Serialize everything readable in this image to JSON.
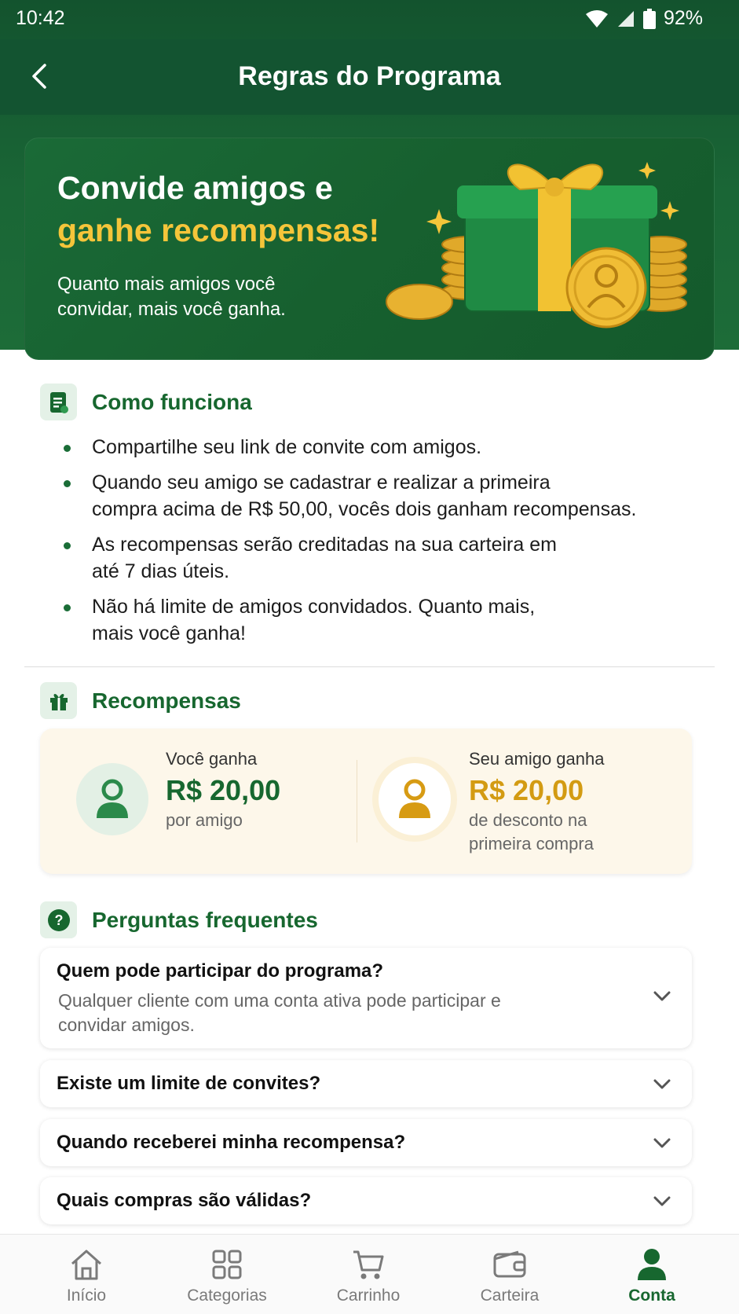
{
  "status_bar": {
    "time": "10:42",
    "battery": "92%"
  },
  "header": {
    "title": "Regras do Programa"
  },
  "hero": {
    "title_line1": "Convide amigos e",
    "title_line2": "ganhe recompensas!",
    "subtitle": "Quanto mais amigos você convidar, mais você ganha."
  },
  "how_it_works": {
    "title": "Como funciona",
    "items": [
      [
        "Compartilhe seu link de convite com amigos."
      ],
      [
        "Quando seu amigo se cadastrar e realizar a primeira",
        "compra acima de R$ 50,00, vocês dois ganham recompensas."
      ],
      [
        "As recompensas serão creditadas na sua carteira em",
        "até 7 dias úteis."
      ],
      [
        "Não há limite de amigos convidados. Quanto mais,",
        "mais você ganha!"
      ]
    ]
  },
  "rewards": {
    "title": "Recompensas",
    "you": {
      "label": "Você ganha",
      "amount": "R$ 20,00",
      "desc": "por amigo"
    },
    "friend": {
      "label": "Seu amigo ganha",
      "amount": "R$ 20,00",
      "desc_line1": "de desconto na",
      "desc_line2": "primeira compra"
    }
  },
  "faq": {
    "title": "Perguntas frequentes",
    "items": [
      {
        "q": "Quem pode participar do programa?",
        "a_line1": "Qualquer cliente com uma conta ativa pode participar e",
        "a_line2": "convidar amigos."
      },
      {
        "q": "Existe um limite de convites?"
      },
      {
        "q": "Quando receberei minha recompensa?"
      },
      {
        "q": "Quais compras são válidas?"
      }
    ]
  },
  "bottom_nav": {
    "items": [
      {
        "label": "Início",
        "icon": "home-icon"
      },
      {
        "label": "Categorias",
        "icon": "grid-icon"
      },
      {
        "label": "Carrinho",
        "icon": "cart-icon"
      },
      {
        "label": "Carteira",
        "icon": "wallet-icon"
      },
      {
        "label": "Conta",
        "icon": "person-icon",
        "active": true
      }
    ]
  },
  "colors": {
    "primary_green": "#17672f",
    "header_green": "#135431",
    "gold": "#f5c53a",
    "reward_gold": "#d39b12"
  }
}
